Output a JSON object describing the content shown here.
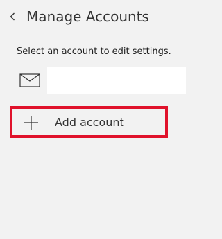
{
  "header": {
    "title": "Manage Accounts",
    "back_icon": "chevron-left-icon"
  },
  "main": {
    "instruction": "Select an account to edit settings.",
    "account": {
      "icon": "mail-icon",
      "value": ""
    },
    "add_account": {
      "icon": "plus-icon",
      "label": "Add account",
      "highlight_color": "#e0122b"
    }
  }
}
